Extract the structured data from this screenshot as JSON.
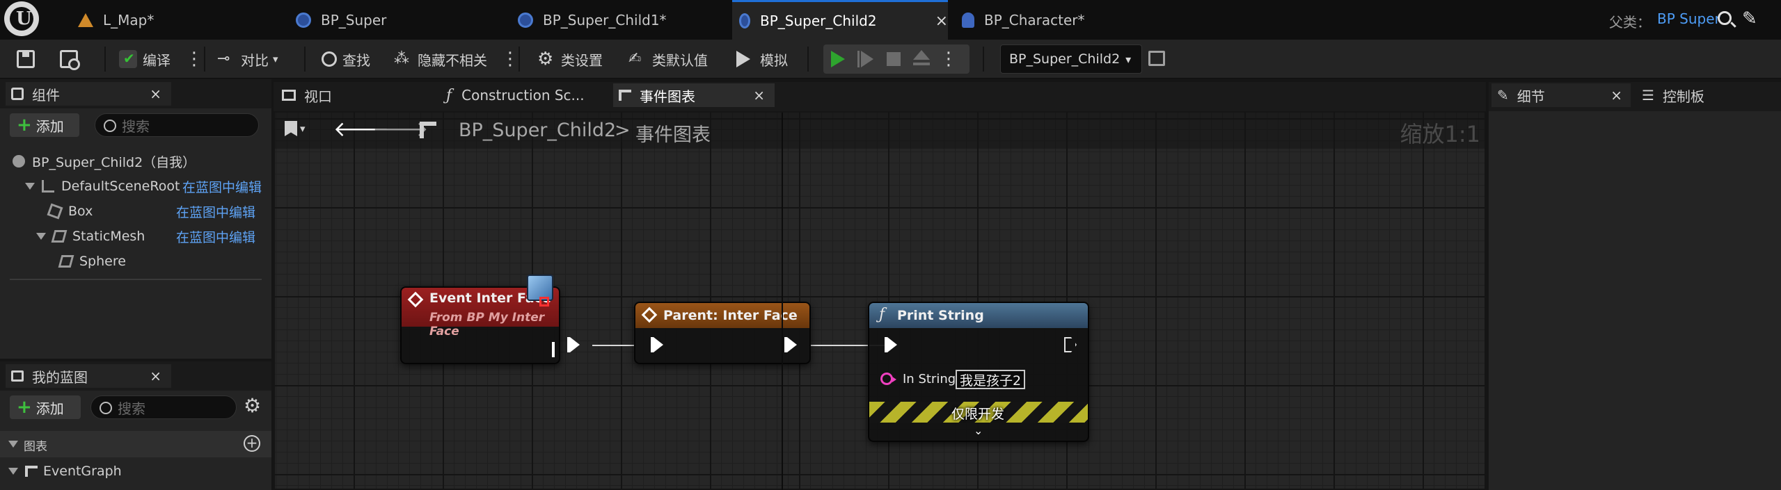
{
  "tabs": [
    {
      "label": "L_Map*",
      "icon": "map-icon"
    },
    {
      "label": "BP_Super",
      "icon": "blueprint-icon"
    },
    {
      "label": "BP_Super_Child1*",
      "icon": "blueprint-icon"
    },
    {
      "label": "BP_Super_Child2",
      "icon": "blueprint-icon",
      "active": true,
      "close": "×"
    },
    {
      "label": "BP_Character*",
      "icon": "character-blueprint-icon"
    }
  ],
  "parent_class": {
    "label": "父类：",
    "value": "BP Super"
  },
  "toolbar": {
    "compile": "编译",
    "diff": "对比",
    "find": "查找",
    "hide_unrelated": "隐藏不相关",
    "class_settings": "类设置",
    "class_defaults": "类默认值",
    "simulate": "模拟",
    "debug_object": "BP_Super_Child2"
  },
  "components_panel": {
    "title": "组件",
    "close": "×",
    "add_label": "添加",
    "search_placeholder": "搜索",
    "items": [
      {
        "label": "BP_Super_Child2（自我）"
      },
      {
        "label": "DefaultSceneRoot",
        "link": "在蓝图中编辑"
      },
      {
        "label": "Box",
        "link": "在蓝图中编辑"
      },
      {
        "label": "StaticMesh",
        "link": "在蓝图中编辑"
      },
      {
        "label": "Sphere"
      }
    ]
  },
  "my_blueprint_panel": {
    "title": "我的蓝图",
    "close": "×",
    "add_label": "添加",
    "search_placeholder": "搜索",
    "section_graphs": "图表",
    "graph_item": "EventGraph"
  },
  "editor_tabs": [
    {
      "label": "视口",
      "icon": "viewport-icon"
    },
    {
      "label": "Construction Sc...",
      "icon": "function-icon"
    },
    {
      "label": "事件图表",
      "icon": "event-graph-icon",
      "active": true,
      "close": "×"
    }
  ],
  "graph": {
    "breadcrumb_root": "BP_Super_Child2",
    "breadcrumb_sep": ">",
    "breadcrumb_leaf": "事件图表",
    "zoom": "缩放1:1",
    "nodes": {
      "event": {
        "title": "Event Inter Face",
        "subtitle": "From BP My Inter Face",
        "color": "#8e1d1d"
      },
      "parent": {
        "title": "Parent: Inter Face",
        "color": "#8a4a12"
      },
      "print": {
        "title": "Print String",
        "color": "#3d5f7e",
        "pin_label": "In String",
        "pin_value": "我是孩子2",
        "dev_only": "仅限开发"
      }
    }
  },
  "right_tabs": [
    {
      "label": "细节",
      "icon": "details-icon",
      "close": "×"
    },
    {
      "label": "控制板",
      "icon": "palette-icon"
    }
  ],
  "colors": {
    "accent": "#1f6fd6",
    "link": "#5ea3f5",
    "exec": "#ffffff",
    "string_pin": "#f040c0",
    "add_plus": "#3ec03e"
  }
}
